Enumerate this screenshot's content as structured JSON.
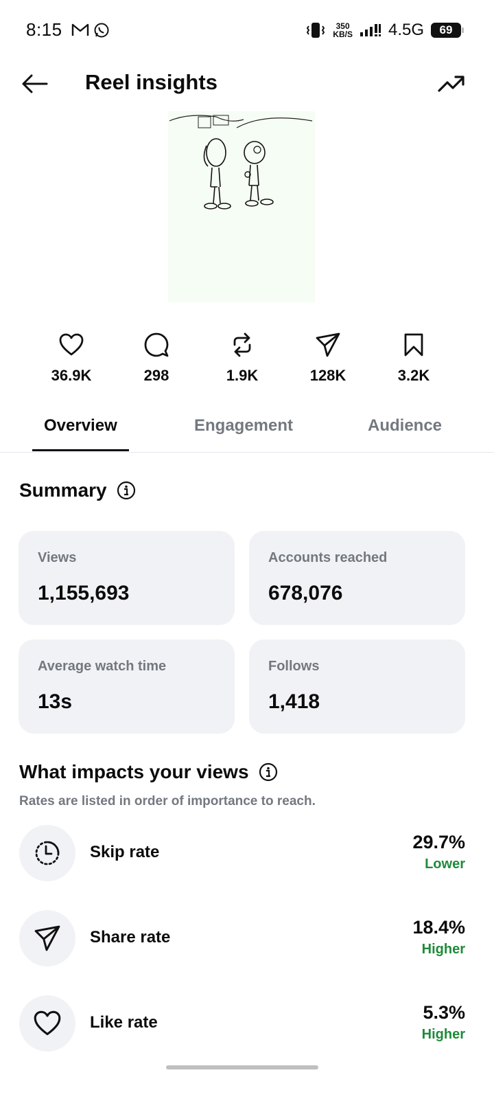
{
  "status_bar": {
    "time": "8:15",
    "speed_value": "350",
    "speed_unit": "KB/S",
    "network": "4.5G",
    "battery": "69"
  },
  "header": {
    "title": "Reel insights"
  },
  "stats": [
    {
      "icon": "heart-icon",
      "value": "36.9K"
    },
    {
      "icon": "comment-icon",
      "value": "298"
    },
    {
      "icon": "repost-icon",
      "value": "1.9K"
    },
    {
      "icon": "share-icon",
      "value": "128K"
    },
    {
      "icon": "bookmark-icon",
      "value": "3.2K"
    }
  ],
  "tabs": [
    {
      "label": "Overview",
      "active": true
    },
    {
      "label": "Engagement",
      "active": false
    },
    {
      "label": "Audience",
      "active": false
    }
  ],
  "summary": {
    "title": "Summary",
    "cards": [
      {
        "label": "Views",
        "value": "1,155,693"
      },
      {
        "label": "Accounts reached",
        "value": "678,076"
      },
      {
        "label": "Average watch time",
        "value": "13s"
      },
      {
        "label": "Follows",
        "value": "1,418"
      }
    ]
  },
  "impacts": {
    "title": "What impacts your views",
    "subtitle": "Rates are listed in order of importance to reach.",
    "rates": [
      {
        "icon": "timer-icon",
        "name": "Skip rate",
        "value": "29.7%",
        "comparison": "Lower"
      },
      {
        "icon": "share-icon",
        "name": "Share rate",
        "value": "18.4%",
        "comparison": "Higher"
      },
      {
        "icon": "heart-icon",
        "name": "Like rate",
        "value": "5.3%",
        "comparison": "Higher"
      }
    ]
  },
  "colors": {
    "accent_positive": "#1f8a3a",
    "muted_text": "#737880",
    "card_bg": "#f1f2f5"
  }
}
